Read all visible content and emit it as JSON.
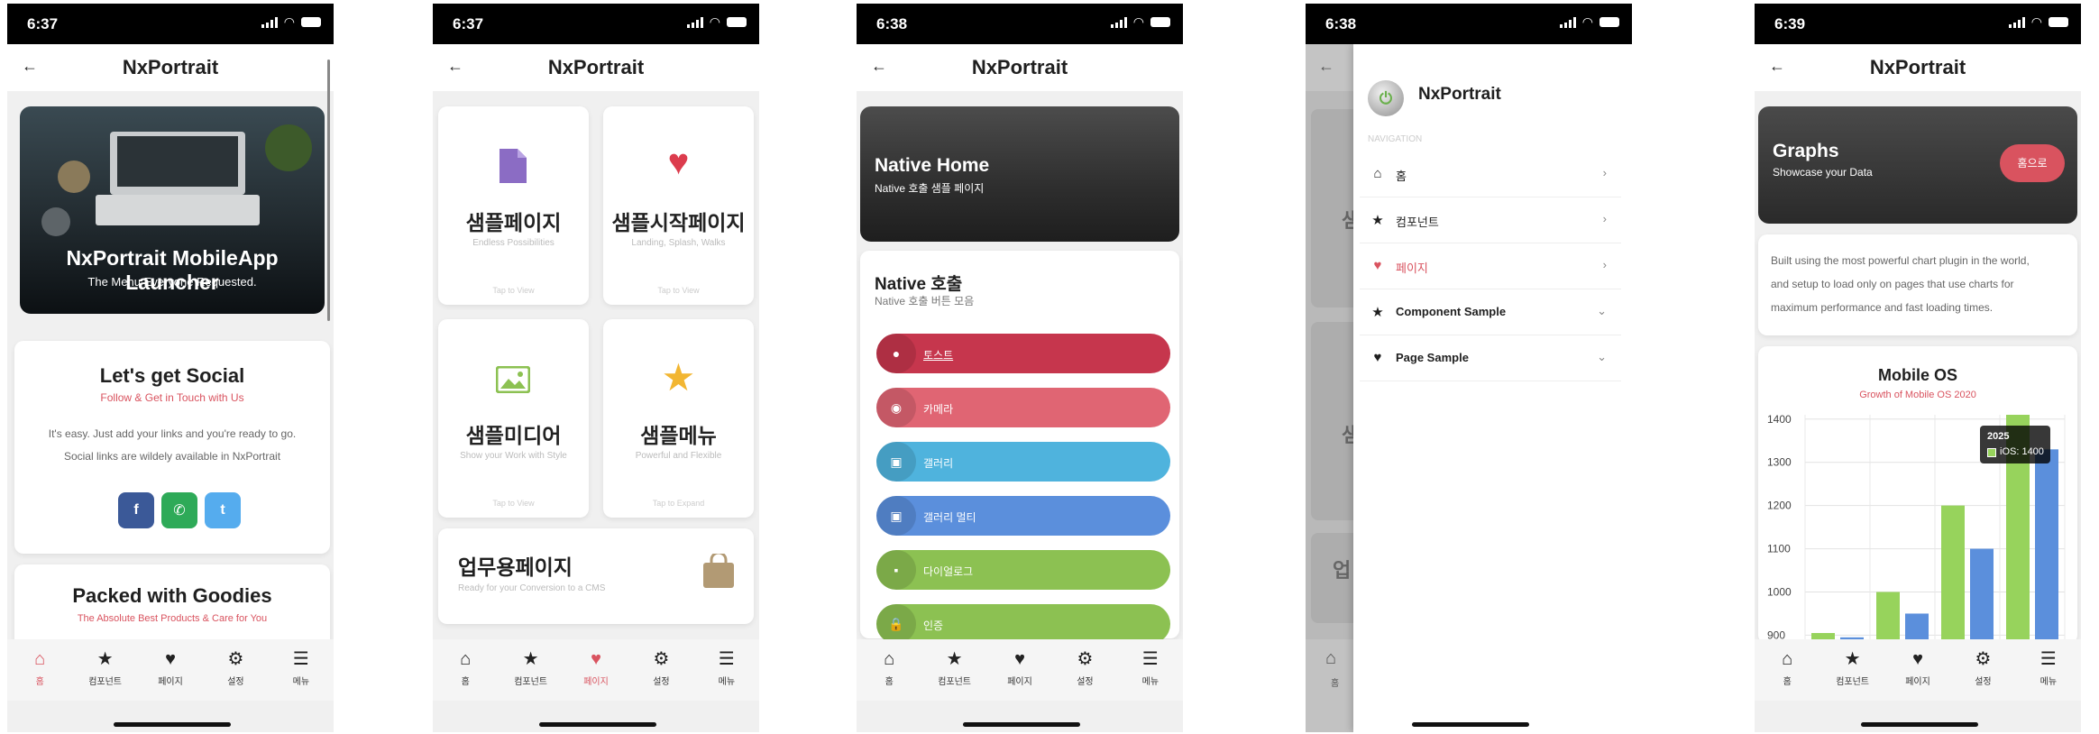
{
  "status": {
    "time_1": "6:37",
    "time_2": "6:37",
    "time_3": "6:38",
    "time_4": "6:38",
    "time_5": "6:39"
  },
  "app_title": "NxPortrait",
  "tabs": [
    {
      "label": "홈",
      "icon": "home-icon"
    },
    {
      "label": "컴포넌트",
      "icon": "star-icon"
    },
    {
      "label": "페이지",
      "icon": "heart-icon"
    },
    {
      "label": "설정",
      "icon": "gear-icon"
    },
    {
      "label": "메뉴",
      "icon": "menu-icon"
    }
  ],
  "screen1": {
    "hero_title": "NxPortrait MobileApp Launcher",
    "hero_sub": "The Menu Everyone Requested.",
    "social_title": "Let's get Social",
    "social_sub": "Follow & Get in Touch with Us",
    "social_body_1": "It's easy. Just add your links and you're ready to go.",
    "social_body_2": "Social links are wildely available in NxPortrait",
    "social_buttons": {
      "facebook": "f",
      "phone": "✆",
      "twitter": "t"
    },
    "goodies_title": "Packed with Goodies",
    "goodies_sub": "The Absolute Best Products & Care for You"
  },
  "screen2": {
    "tiles": [
      {
        "title": "샘플페이지",
        "sub": "Endless Possibilities",
        "foot": "Tap to View"
      },
      {
        "title": "샘플시작페이지",
        "sub": "Landing, Splash, Walks",
        "foot": "Tap to View"
      },
      {
        "title": "샘플미디어",
        "sub": "Show your Work with Style",
        "foot": "Tap to View"
      },
      {
        "title": "샘플메뉴",
        "sub": "Powerful and Flexible",
        "foot": "Tap to Expand"
      }
    ],
    "work_title": "업무용페이지",
    "work_sub": "Ready for your Conversion to a CMS"
  },
  "screen3": {
    "hero_title": "Native Home",
    "hero_sub": "Native 호출 샘플 페이지",
    "section_title": "Native 호출",
    "section_sub": "Native 호출 버튼 모음",
    "buttons": [
      {
        "label": "토스트",
        "color": "#c6364d"
      },
      {
        "label": "카메라",
        "color": "#e06573"
      },
      {
        "label": "갤러리",
        "color": "#4fb3dd"
      },
      {
        "label": "갤러리 멀티",
        "color": "#5b8fdc"
      },
      {
        "label": "다이얼로그",
        "color": "#8cc152"
      },
      {
        "label": "인증",
        "color": "#8cc152"
      }
    ]
  },
  "screen4": {
    "brand": "NxPortrait",
    "nav_header": "NAVIGATION",
    "items": [
      {
        "label": "홈",
        "chev": "›"
      },
      {
        "label": "컴포넌트",
        "chev": "›"
      },
      {
        "label": "페이지",
        "chev": "›"
      },
      {
        "label": "Component Sample",
        "chev": "⌄"
      },
      {
        "label": "Page Sample",
        "chev": "⌄"
      }
    ],
    "peek_1": "샘",
    "peek_2": "샘",
    "peek_3": "업"
  },
  "screen5": {
    "hero_title": "Graphs",
    "hero_sub": "Showcase your Data",
    "home_button": "홈으로",
    "body_1": "Built using the most powerful chart plugin in the world,",
    "body_2": "and setup to load only on pages that use charts for",
    "body_3": "maximum performance and fast loading times.",
    "chart_title": "Mobile OS",
    "chart_sub": "Growth of Mobile OS 2020",
    "tooltip_year": "2025",
    "tooltip_value": "iOS: 1400"
  },
  "chart_data": {
    "type": "bar",
    "title": "Mobile OS",
    "subtitle": "Growth of Mobile OS 2020",
    "y_ticks": [
      900,
      1000,
      1100,
      1200,
      1300,
      1400
    ],
    "visible_range": [
      880,
      1410
    ],
    "series": [
      {
        "color": "#97d35c",
        "values": [
          905,
          1000,
          1200,
          1410
        ]
      },
      {
        "color": "#5b8fdc",
        "values": [
          895,
          950,
          1100,
          1330
        ]
      }
    ]
  },
  "colors": {
    "accent": "#d9535f",
    "facebook": "#3b5998",
    "phone": "#2eaa58",
    "twitter": "#55acee"
  }
}
